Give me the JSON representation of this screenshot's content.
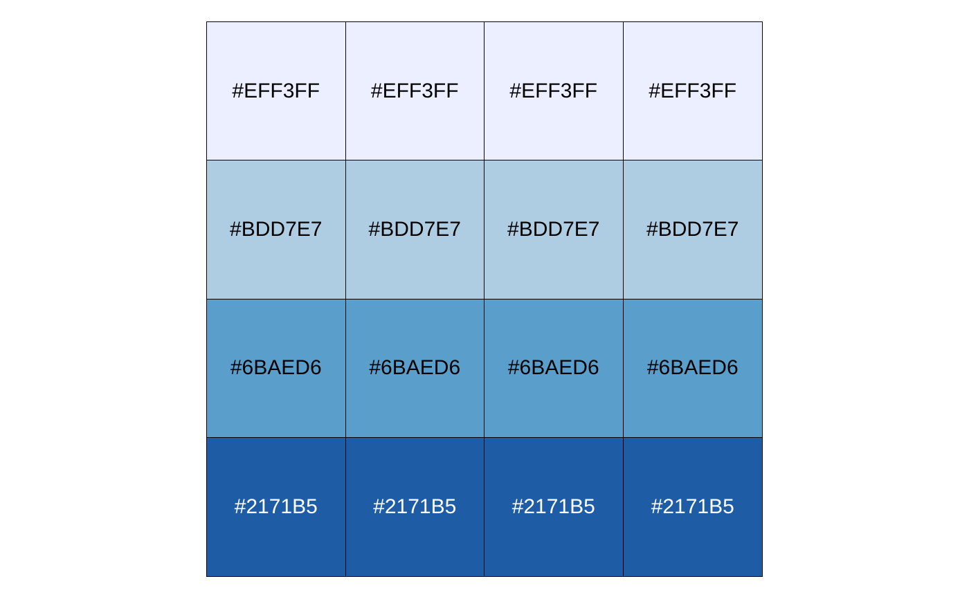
{
  "chart_data": {
    "type": "heatmap",
    "rows": 4,
    "cols": 4,
    "cells": [
      [
        {
          "label": "#EFF3FF",
          "fill": "#EBEFFF",
          "text_color": "#000000"
        },
        {
          "label": "#EFF3FF",
          "fill": "#EBEFFF",
          "text_color": "#000000"
        },
        {
          "label": "#EFF3FF",
          "fill": "#EBEFFF",
          "text_color": "#000000"
        },
        {
          "label": "#EFF3FF",
          "fill": "#EBEFFF",
          "text_color": "#000000"
        }
      ],
      [
        {
          "label": "#BDD7E7",
          "fill": "#AFCDE2",
          "text_color": "#000000"
        },
        {
          "label": "#BDD7E7",
          "fill": "#AFCDE2",
          "text_color": "#000000"
        },
        {
          "label": "#BDD7E7",
          "fill": "#AFCDE2",
          "text_color": "#000000"
        },
        {
          "label": "#BDD7E7",
          "fill": "#AFCDE2",
          "text_color": "#000000"
        }
      ],
      [
        {
          "label": "#6BAED6",
          "fill": "#5A9FCB",
          "text_color": "#000000"
        },
        {
          "label": "#6BAED6",
          "fill": "#5A9FCB",
          "text_color": "#000000"
        },
        {
          "label": "#6BAED6",
          "fill": "#5A9FCB",
          "text_color": "#000000"
        },
        {
          "label": "#6BAED6",
          "fill": "#5A9FCB",
          "text_color": "#000000"
        }
      ],
      [
        {
          "label": "#2171B5",
          "fill": "#1E5DA5",
          "text_color": "#FFFFFF"
        },
        {
          "label": "#2171B5",
          "fill": "#1E5DA5",
          "text_color": "#FFFFFF"
        },
        {
          "label": "#2171B5",
          "fill": "#1E5DA5",
          "text_color": "#FFFFFF"
        },
        {
          "label": "#2171B5",
          "fill": "#1E5DA5",
          "text_color": "#FFFFFF"
        }
      ]
    ],
    "border_color": "#000000",
    "background": "#FFFFFF"
  }
}
